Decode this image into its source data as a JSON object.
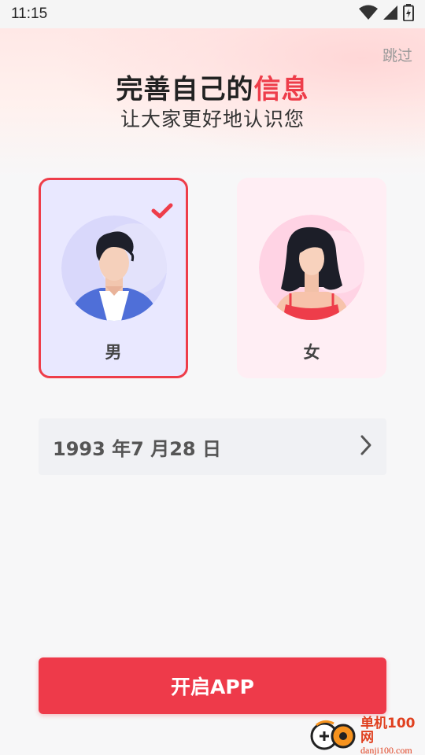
{
  "status_bar": {
    "time": "11:15"
  },
  "header": {
    "skip_label": "跳过",
    "title_main": "完善自己的",
    "title_accent": "信息",
    "subtitle": "让大家更好地认识您"
  },
  "gender": {
    "selected": "male",
    "options": [
      {
        "id": "male",
        "label": "男"
      },
      {
        "id": "female",
        "label": "女"
      }
    ]
  },
  "birthday": {
    "value": "1993 年7 月28 日"
  },
  "actions": {
    "start_label": "开启APP"
  },
  "watermark": {
    "name": "单机100网",
    "url": "danji100.com"
  },
  "colors": {
    "accent": "#ee3d4a",
    "male_card_bg": "#e9e8ff",
    "female_card_bg": "#ffeef4"
  },
  "icons": [
    "wifi-icon",
    "signal-icon",
    "battery-icon",
    "check-icon",
    "chevron-right-icon"
  ]
}
